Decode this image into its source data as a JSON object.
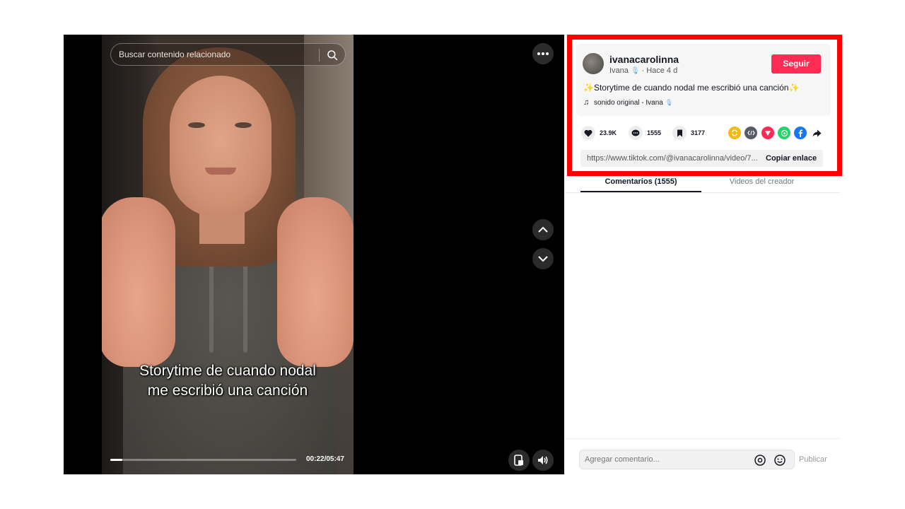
{
  "video": {
    "search_placeholder": "Buscar contenido relacionado",
    "caption_line1": "Storytime de cuando nodal",
    "caption_line2": "me escribió una canción",
    "time": "00:22/05:47",
    "progress_fraction": 0.063
  },
  "post": {
    "username": "ivanacarolinna",
    "display_name": "Ivana",
    "age": "· Hace 4 d",
    "follow_label": "Seguir",
    "description": "✨Storytime de cuando nodal me escribió una canción✨",
    "sound": "sonido original - Ivana",
    "likes": "23.9K",
    "comments": "1555",
    "saves": "3177",
    "link": "https://www.tiktok.com/@ivanacarolinna/video/7...",
    "copy_label": "Copiar enlace"
  },
  "tabs": {
    "comments": "Comentarios (1555)",
    "videos": "Videos del creador"
  },
  "comment_input": {
    "placeholder": "Agregar comentario...",
    "publish_label": "Publicar"
  },
  "colors": {
    "accent": "#fe2c55",
    "highlight_frame": "#ff0000"
  },
  "share_icons": [
    "repost-icon",
    "embed-icon",
    "send-icon",
    "whatsapp-icon",
    "facebook-icon",
    "share-arrow-icon"
  ]
}
